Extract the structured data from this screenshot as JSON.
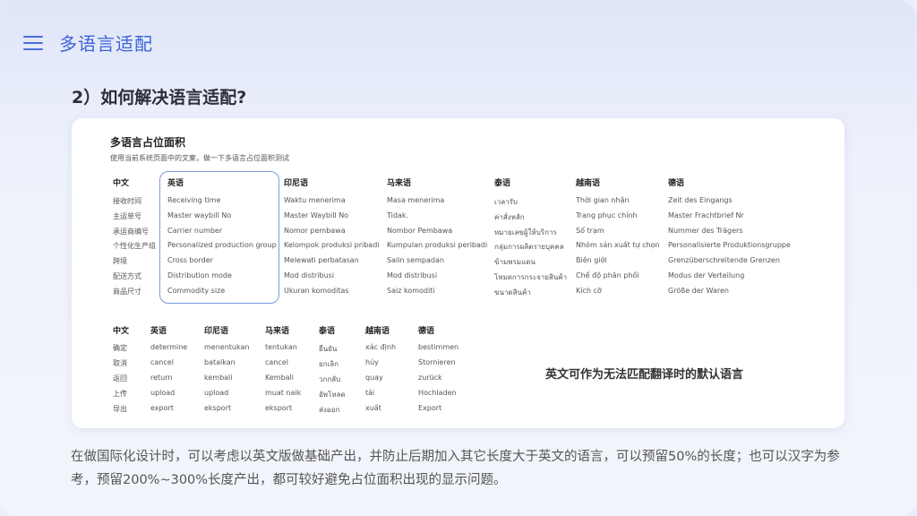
{
  "header": {
    "title": "多语言适配",
    "menu_icon": "hamburger-menu-icon"
  },
  "section_title": "2）如何解决语言适配?",
  "card": {
    "title": "多语言占位面积",
    "subtitle": "使用当前系统页面中的文案，做一下多语言占位面积测试",
    "table1": {
      "headers": [
        "中文",
        "英语",
        "印尼语",
        "马来语",
        "泰语",
        "越南语",
        "德语"
      ],
      "rows": [
        [
          "接收时间",
          "Receiving time",
          "Waktu menerima",
          "Masa menerima",
          "เวลารับ",
          "Thời gian nhận",
          "Zeit des Eingangs"
        ],
        [
          "主运单号",
          "Master waybill No",
          "Master Waybill No",
          "Tidak.",
          "ค่าสั่งหลัก",
          "Trang phục chính",
          "Master Frachtbrief Nr"
        ],
        [
          "承运商编号",
          "Carrier number",
          "Nomor pembawa",
          "Nombor Pembawa",
          "หมายเลขผู้ให้บริการ",
          "Số trạm",
          "Nummer des Trägers"
        ],
        [
          "个性化生产组",
          "Personalized production group",
          "Kelompok produksi pribadi",
          "Kumpulan produksi peribadi",
          "กลุ่มการผลิตรายบุคคล",
          "Nhóm sản xuất tự chọn",
          "Personalisierte Produktionsgruppe"
        ],
        [
          "跨境",
          "Cross border",
          "Melewati perbatasan",
          "Salin sempadan",
          "ข้ามพรมแดน",
          "Biên giới",
          "Grenzüberschreitende Grenzen"
        ],
        [
          "配送方式",
          "Distribution mode",
          "Mod distribusi",
          "Mod distribusi",
          "โหมดการกระจายสินค้า",
          "Chế độ phân phối",
          "Modus der Verteilung"
        ],
        [
          "商品尺寸",
          "Commodity size",
          "Ukuran komoditas",
          "Saiz komoditi",
          "ขนาดสินค้า",
          "Kích cỡ",
          "Größe der Waren"
        ]
      ]
    },
    "table2": {
      "headers": [
        "中文",
        "英语",
        "印尼语",
        "马来语",
        "泰语",
        "越南语",
        "德语"
      ],
      "rows": [
        [
          "确定",
          "determine",
          "menentukan",
          "tentukan",
          "ยืนยัน",
          "xác định",
          "bestimmen"
        ],
        [
          "取消",
          "cancel",
          "batalkan",
          "cancel",
          "ยกเลิก",
          "hủy",
          "Stornieren"
        ],
        [
          "返回",
          "return",
          "kembali",
          "Kembali",
          "วกกลับ",
          "quay",
          "zurück"
        ],
        [
          "上传",
          "upload",
          "upload",
          "muat naik",
          "อัพโหลด",
          "tải",
          "Hochladen"
        ],
        [
          "导出",
          "export",
          "eksport",
          "eksport",
          "ส่งออก",
          "xuất",
          "Export"
        ]
      ]
    },
    "note": "英文可作为无法匹配翻译时的默认语言"
  },
  "footer": "在做国际化设计时，可以考虑以英文版做基础产出，并防止后期加入其它长度大于英文的语言，可以预留50%的长度；也可以汉字为参考，预留200%~300%长度产出，都可较好避免占位面积出现的显示问题。"
}
